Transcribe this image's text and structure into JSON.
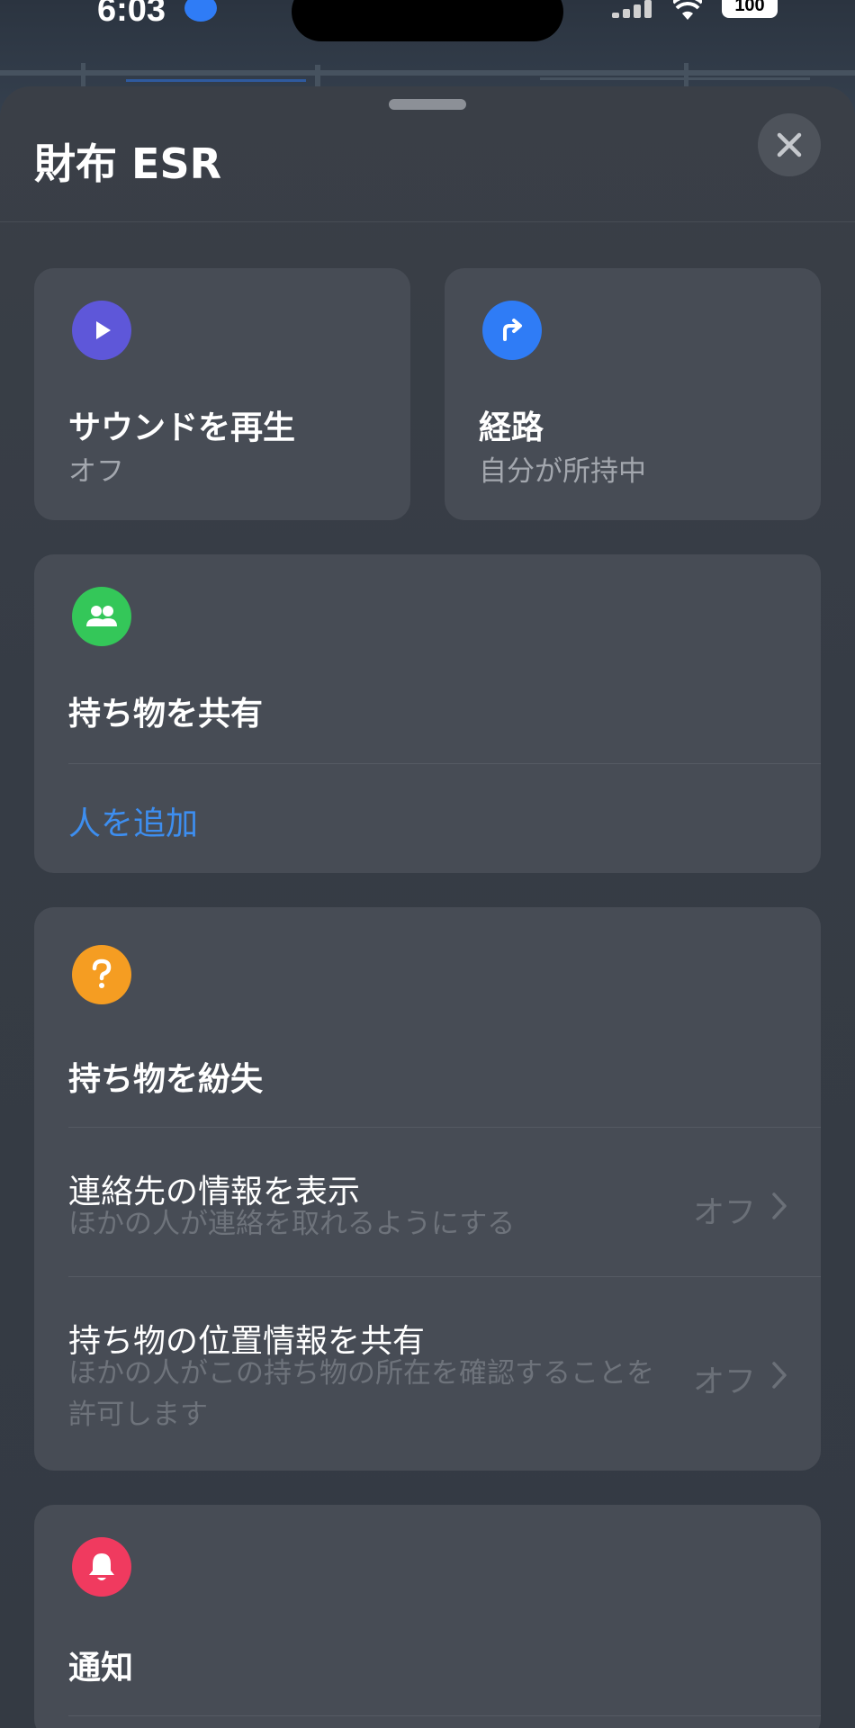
{
  "status_bar": {
    "time": "6:03",
    "battery": "100"
  },
  "sheet": {
    "title": "財布 ESR"
  },
  "actions": {
    "play_sound": {
      "title": "サウンドを再生",
      "subtitle": "オフ"
    },
    "directions": {
      "title": "経路",
      "subtitle": "自分が所持中"
    }
  },
  "share_item": {
    "title": "持ち物を共有",
    "add_person": "人を追加"
  },
  "lost_item": {
    "title": "持ち物を紛失",
    "rows": [
      {
        "title": "連絡先の情報を表示",
        "description": "ほかの人が連絡を取れるようにする",
        "value": "オフ"
      },
      {
        "title": "持ち物の位置情報を共有",
        "description": "ほかの人がこの持ち物の所在を確認することを許可します",
        "value": "オフ"
      }
    ]
  },
  "notifications": {
    "title": "通知"
  },
  "colors": {
    "play_icon": "#5e57d9",
    "directions_icon": "#2f7cf6",
    "share_icon": "#34c759",
    "lost_icon": "#f59d22",
    "notify_icon": "#f03a5f",
    "link": "#3d8ef0"
  }
}
